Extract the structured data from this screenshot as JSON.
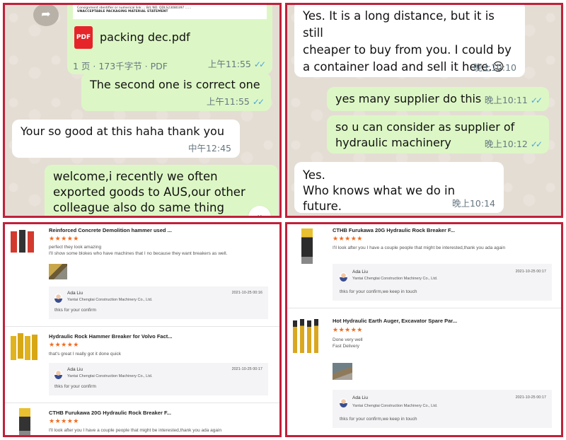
{
  "chat_left": {
    "doc_header": {
      "lines": [
        "Consignment identifier or numerical link ...  B/L NO. QDLS23080397 ......",
        "UNACCEPTABLE PACKAGING MATERIAL STATEMENT"
      ]
    },
    "doc_icon_label": "PDF",
    "doc_name": "packing dec.pdf",
    "doc_meta": "1 页 · 173千字节 · PDF",
    "doc_time": "上午11:55",
    "messages": [
      {
        "text": "The second one is correct one",
        "time": "上午11:55"
      },
      {
        "text": "Your so good at this haha thank you",
        "time": "中午12:45"
      },
      {
        "text": "welcome,i recently we often\nexported goods to AUS,our other\ncolleague also do same thing",
        "time": ""
      }
    ],
    "scroll_icon": "double-chevron-down-icon"
  },
  "chat_right": {
    "messages": [
      {
        "text": "Yes. It is a long distance, but it is still\ncheaper to buy from you. I could by\na container load and sell it here.😌",
        "time": "晚上10:10"
      },
      {
        "text": "yes many supplier do this",
        "time": "晚上10:11"
      },
      {
        "text": "so u can consider as supplier of\nhydraulic machinery",
        "time": "晚上10:12"
      },
      {
        "text": "Yes.\n Who knows what we do in future.",
        "time": "晚上10:14"
      }
    ]
  },
  "reviews_left": {
    "items": [
      {
        "title": "Reinforced Concrete Demolition hammer used ...",
        "stars": "★★★★★",
        "text": [
          "perfect they look amazing",
          "I'll show some blokes who have machines that I no because they want breakers as well."
        ],
        "reply": {
          "name": "Ada Liu",
          "company": "Yantai Chengtai Construction Machinery Co., Ltd.",
          "date": "2021-10-25 00:16",
          "text": "thks for your confirm"
        }
      },
      {
        "title": "Hydraulic Rock Hammer Breaker for Volvo Fact...",
        "stars": "★★★★★",
        "text": [
          "that's great I really got it done quick"
        ],
        "reply": {
          "name": "Ada Liu",
          "company": "Yantai Chengtai Construction Machinery Co., Ltd.",
          "date": "2021-10-25 00:17",
          "text": "thks for your confirm"
        }
      },
      {
        "title": "CTHB Furukawa 20G Hydraulic Rock Breaker F...",
        "stars": "★★★★★",
        "text": [
          "I'll look after you I have a couple people that might be interested,thank you ada again"
        ]
      }
    ]
  },
  "reviews_right": {
    "items": [
      {
        "title": "CTHB Furukawa 20G Hydraulic Rock Breaker F...",
        "stars": "★★★★★",
        "text": [
          "I'll look after you I have a couple people that might be interested,thank you ada again"
        ],
        "reply": {
          "name": "Ada Liu",
          "company": "Yantai Chengtai Construction Machinery Co., Ltd.",
          "date": "2021-10-25 00:17",
          "text": "thks for your confirm,we keep in touch"
        }
      },
      {
        "title": "Hot Hydraulic Earth Auger, Excavator Spare Par...",
        "stars": "★★★★★",
        "text": [
          "Done very well",
          "Fast Delivery"
        ],
        "reply": {
          "name": "Ada Liu",
          "company": "Yantai Chengtai Construction Machinery Co., Ltd.",
          "date": "2021-10-25 00:17",
          "text": "thks for your confirm,we keep in touch"
        }
      }
    ]
  },
  "colors": {
    "frame": "#c0213a",
    "outgoing": "#dcf7c5",
    "incoming": "#ffffff",
    "star": "#f06a1d",
    "tick": "#4fa3e0"
  }
}
